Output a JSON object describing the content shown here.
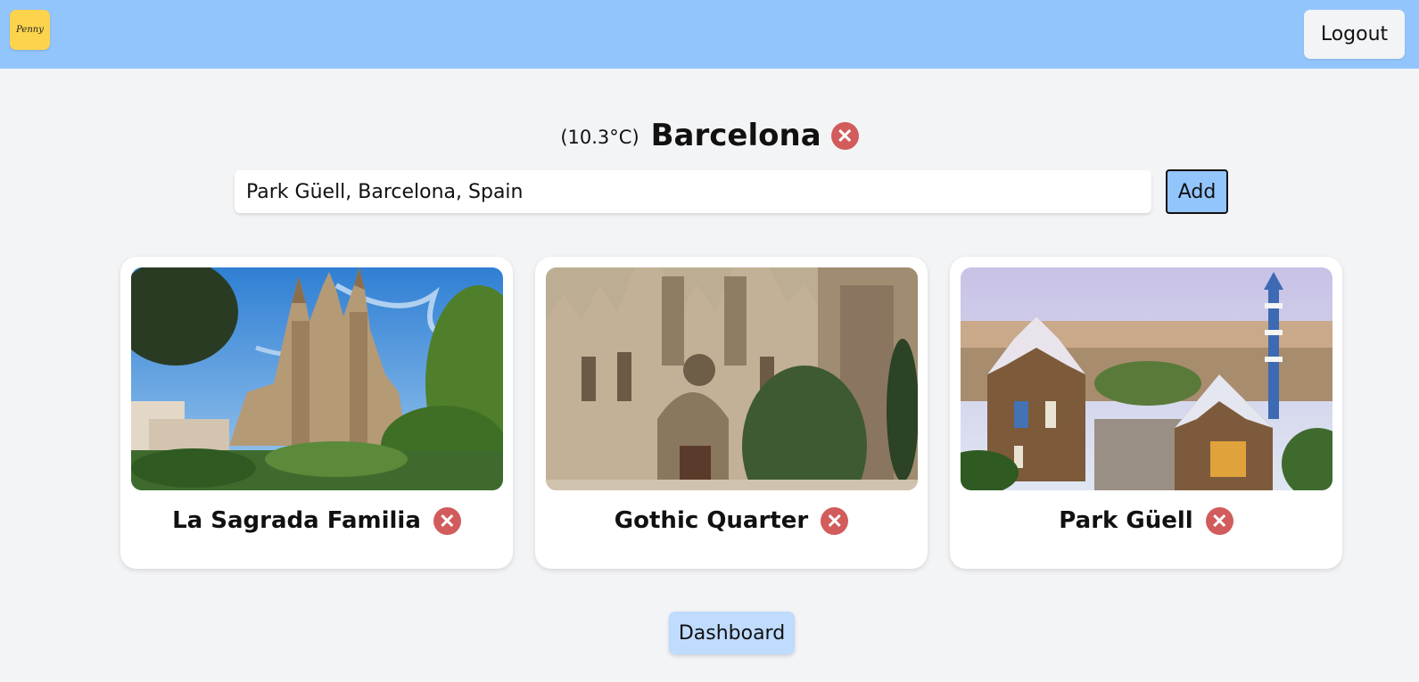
{
  "header": {
    "logo_text": "Penny",
    "logout_label": "Logout"
  },
  "destination": {
    "temperature": "(10.3°C)",
    "city": "Barcelona",
    "remove_icon": "close-icon"
  },
  "search": {
    "value": "Park Güell, Barcelona, Spain",
    "add_label": "Add"
  },
  "places": [
    {
      "name": "La Sagrada Familia",
      "image": "sagrada-familia-photo",
      "remove_icon": "close-icon"
    },
    {
      "name": "Gothic Quarter",
      "image": "gothic-quarter-photo",
      "remove_icon": "close-icon"
    },
    {
      "name": "Park Güell",
      "image": "park-guell-photo",
      "remove_icon": "close-icon"
    }
  ],
  "footer": {
    "dashboard_label": "Dashboard"
  },
  "colors": {
    "topbar": "#93c5fd",
    "logo": "#fcd34d",
    "remove": "#d25b5b",
    "dashboard": "#bfdbfe"
  }
}
